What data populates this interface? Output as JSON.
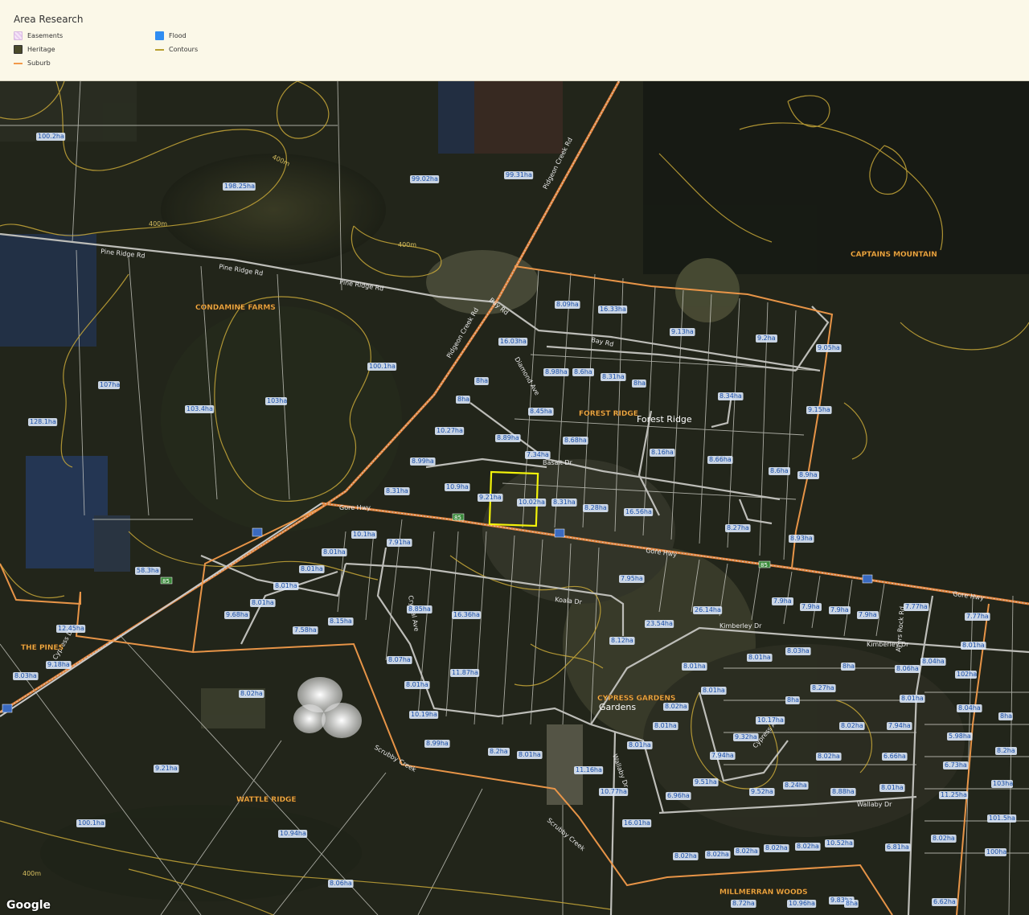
{
  "legend": {
    "title": "Area Research",
    "items": {
      "easements": "Easements",
      "heritage": "Heritage",
      "suburb": "Suburb",
      "flood": "Flood",
      "contours": "Contours"
    }
  },
  "colors": {
    "suburb_boundary": "#f29a4a",
    "contour": "#c8a838",
    "road": "#c9c9c9",
    "highway": "#e8853a",
    "selected_parcel": "#f2f20a",
    "parcel_label_bg": "#dce8fa",
    "parcel_label_text": "#1a4fa8",
    "suburb_label": "#f7b74a"
  },
  "suburbs": [
    "CAPTAINS MOUNTAIN",
    "CONDAMINE FARMS",
    "FOREST RIDGE",
    "THE PINES",
    "CYPRESS GARDENS",
    "WATTLE RIDGE",
    "MILLMERRAN WOODS"
  ],
  "places": [
    "Forest Ridge",
    "Gardens"
  ],
  "roads": [
    "Pine Ridge Rd",
    "Pine Ridge Rd",
    "Pine Ridge Rd",
    "Pidgeon Creek Rd",
    "Pidgeon Creek Rd",
    "Bay Rd",
    "Bay Rd",
    "Diamond Ave",
    "Basalt Dr",
    "Gore Hwy",
    "Gore Hwy",
    "Gore Hwy",
    "Koala Dr",
    "Kimberley Dr",
    "Kimberley Dr",
    "Wallaby Dr",
    "Wallaby Dr",
    "Ayers Rock Rd",
    "Cypress Dr",
    "Scrubby Creek",
    "Scrubby Creek",
    "Crystal Ave",
    "Cypress Ave"
  ],
  "contour_labels": [
    "400m",
    "400m",
    "400m",
    "400m"
  ],
  "route_shields": [
    "85",
    "85",
    "85",
    "85"
  ],
  "parcels": [
    "100.2ha",
    "198.25ha",
    "99.02ha",
    "99.31ha",
    "8.09ha",
    "16.33ha",
    "9.13ha",
    "9.2ha",
    "9.05ha",
    "16.03ha",
    "100.1ha",
    "107ha",
    "103.4ha",
    "103ha",
    "128.1ha",
    "8.98ha",
    "8.6ha",
    "8.31ha",
    "8ha",
    "8ha",
    "8ha",
    "8.34ha",
    "9.15ha",
    "10.27ha",
    "8.89ha",
    "8.45ha",
    "8.68ha",
    "8.99ha",
    "7.34ha",
    "8.16ha",
    "8.66ha",
    "8.6ha",
    "8.9ha",
    "8.31ha",
    "10.9ha",
    "9.21ha",
    "10.02ha",
    "8.31ha",
    "8.28ha",
    "16.56ha",
    "8.27ha",
    "8.93ha",
    "10.1ha",
    "7.91ha",
    "8.01ha",
    "8.01ha",
    "8.01ha",
    "8.01ha",
    "58.3ha",
    "7.95ha",
    "9.68ha",
    "7.58ha",
    "8.15ha",
    "8.85ha",
    "16.36ha",
    "23.54ha",
    "26.14ha",
    "7.9ha",
    "7.9ha",
    "7.9ha",
    "7.9ha",
    "7.77ha",
    "7.77ha",
    "12.45ha",
    "8.12ha",
    "9.18ha",
    "8.03ha",
    "8.07ha",
    "11.87ha",
    "8.01ha",
    "8.03ha",
    "8.04ha",
    "8.01ha",
    "8.01ha",
    "8ha",
    "8.06ha",
    "102ha",
    "8.01ha",
    "8.02ha",
    "8.01ha",
    "8.27ha",
    "8.02ha",
    "8ha",
    "8.04ha",
    "8.01ha",
    "8.01ha",
    "10.17ha",
    "8.02ha",
    "7.94ha",
    "5.98ha",
    "8ha",
    "10.19ha",
    "8.99ha",
    "8.01ha",
    "9.32ha",
    "8.02ha",
    "6.66ha",
    "8.2ha",
    "8.2ha",
    "8.01ha",
    "7.94ha",
    "6.73ha",
    "103ha",
    "9.21ha",
    "11.16ha",
    "9.51ha",
    "9.52ha",
    "8.24ha",
    "8.88ha",
    "8.01ha",
    "11.25ha",
    "10.77ha",
    "6.96ha",
    "101.5ha",
    "100.1ha",
    "10.94ha",
    "16.01ha",
    "8.02ha",
    "8.02ha",
    "8.02ha",
    "8.02ha",
    "8.02ha",
    "8.02ha",
    "10.52ha",
    "6.81ha",
    "100ha",
    "8.06ha",
    "8.72ha",
    "10.96ha",
    "9.83ha",
    "8ha",
    "6.62ha"
  ]
}
